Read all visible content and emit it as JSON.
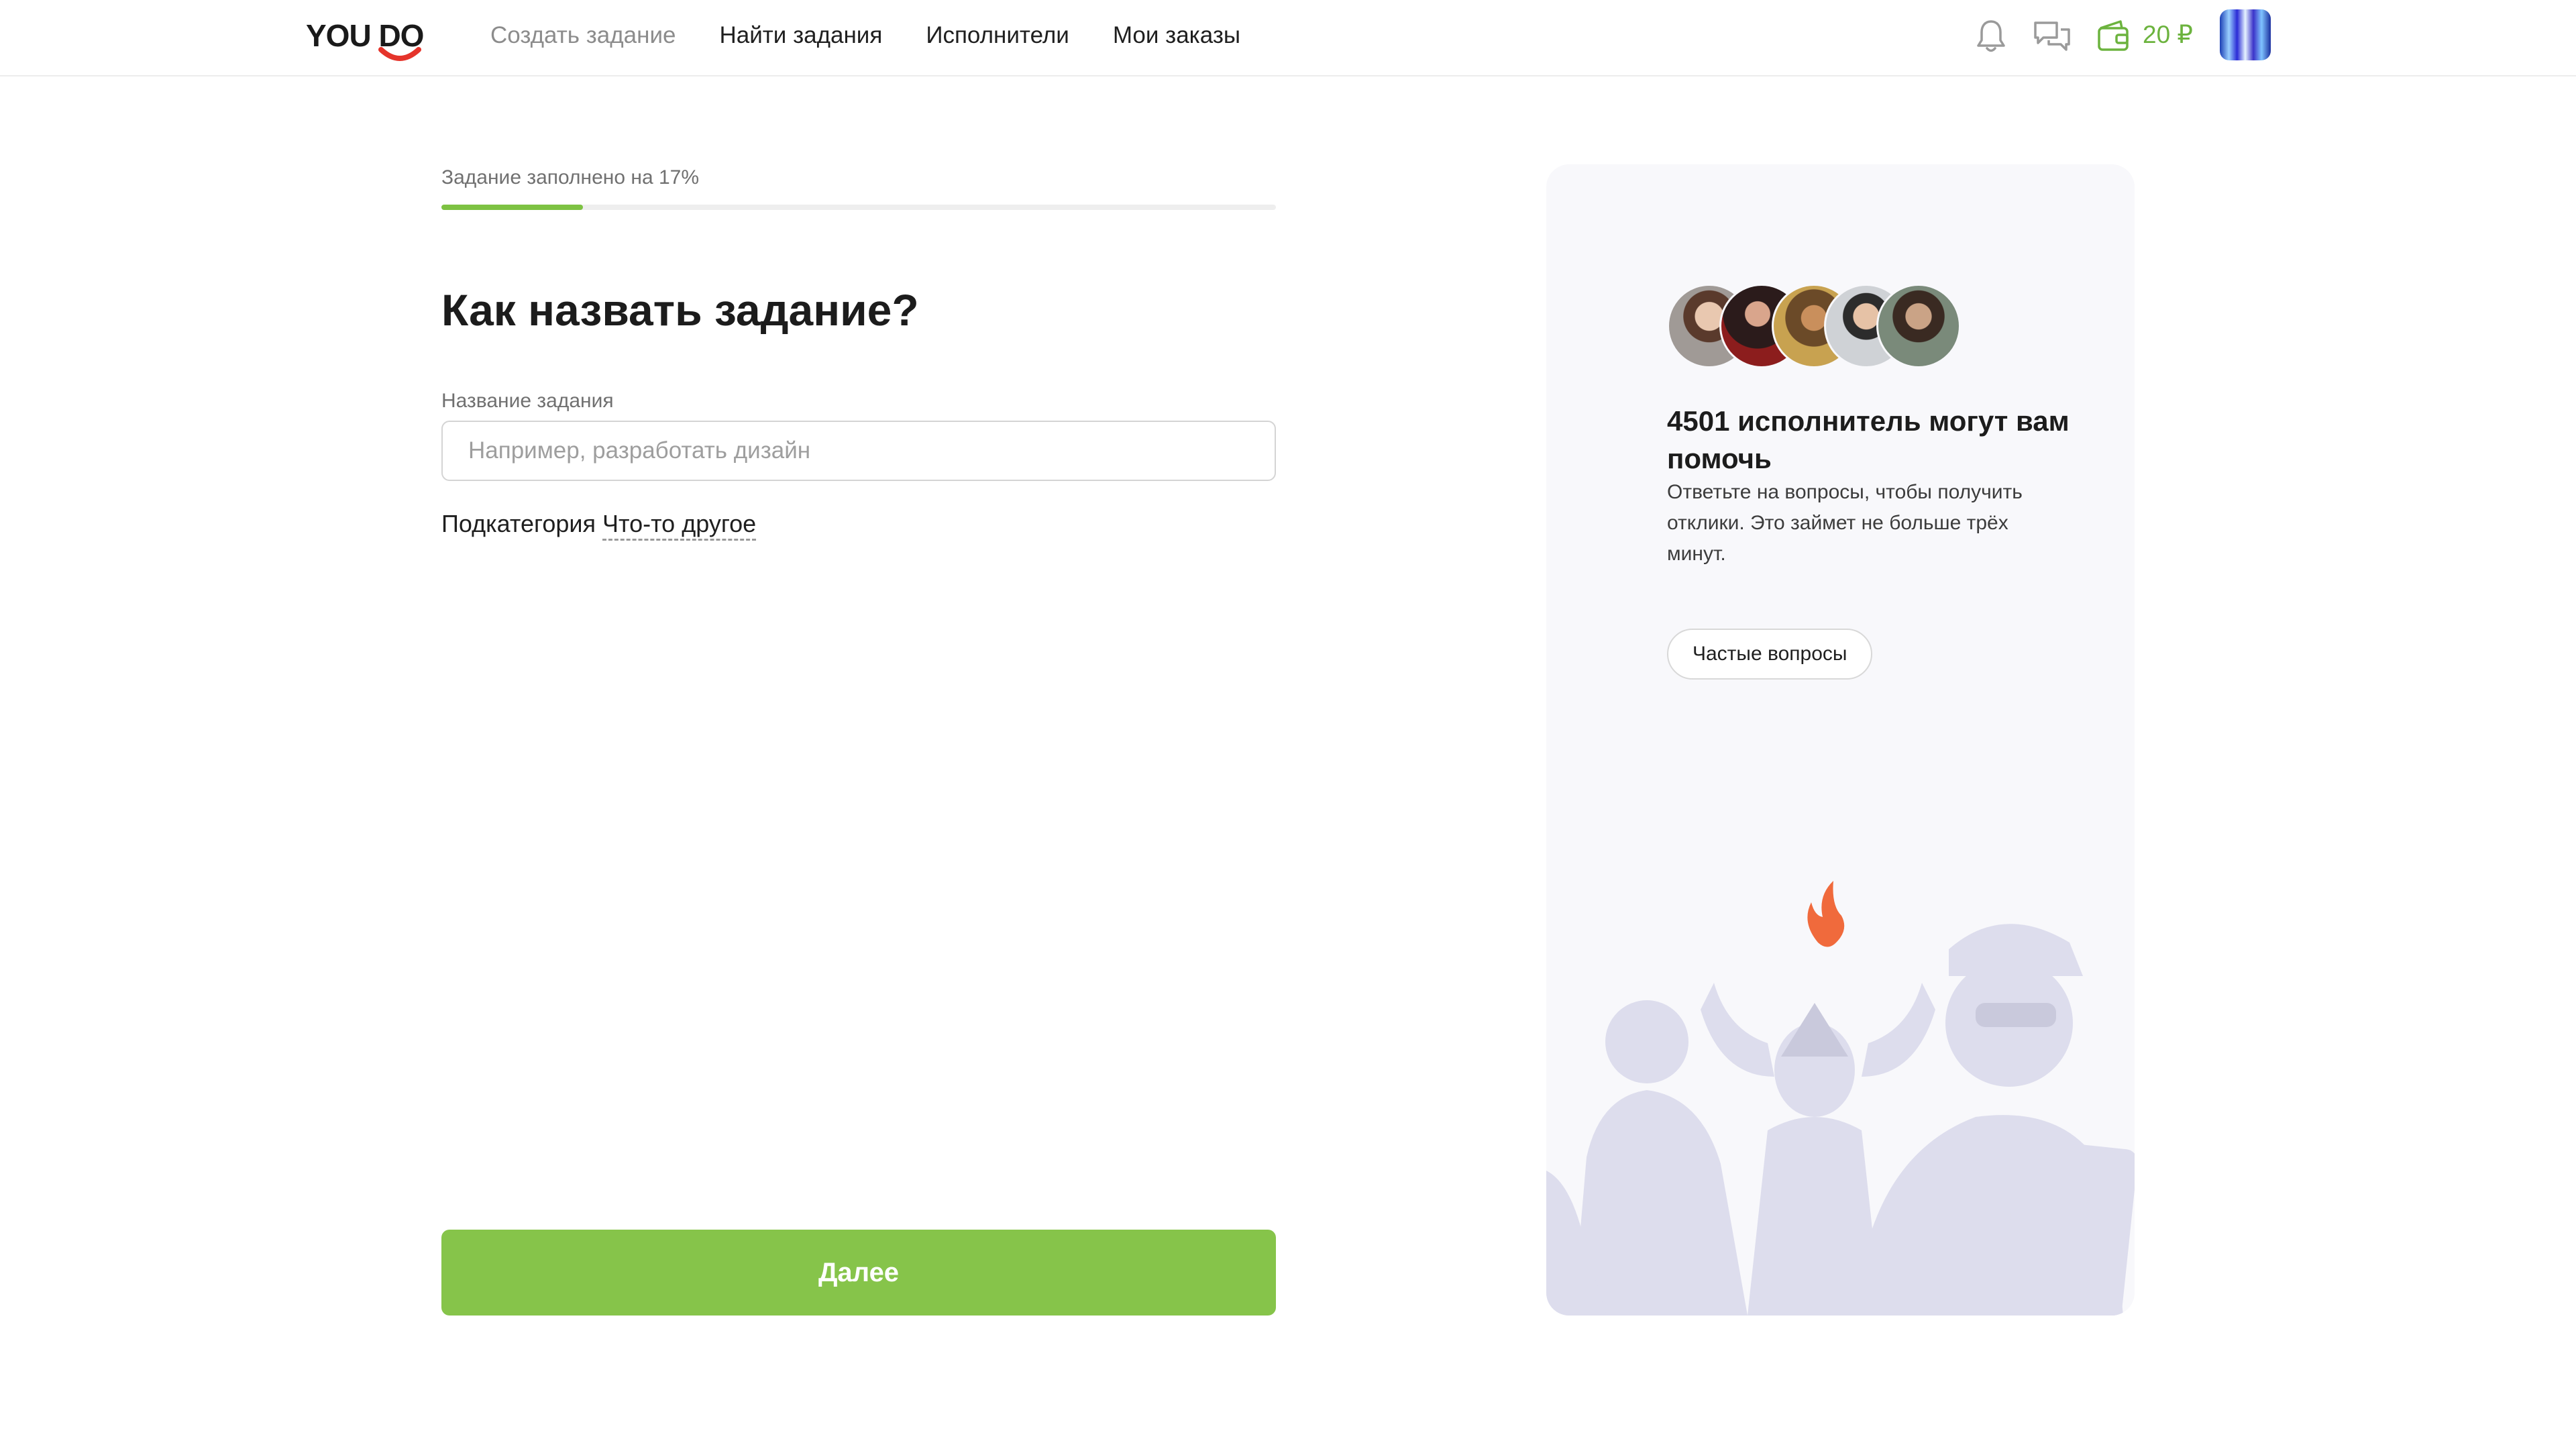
{
  "header": {
    "logo": {
      "text": "YOU DO"
    },
    "nav": [
      {
        "label": "Создать задание",
        "active": false
      },
      {
        "label": "Найти задания"
      },
      {
        "label": "Исполнители"
      },
      {
        "label": "Мои заказы"
      }
    ],
    "icons": [
      "bell-icon",
      "chat-icon",
      "wallet-icon"
    ],
    "balance": "20 ₽"
  },
  "form": {
    "progress_label": "Задание заполнено на 17%",
    "progress_percent": 17,
    "title": "Как назвать задание?",
    "field_label": "Название задания",
    "field_placeholder": "Например, разработать дизайн",
    "field_value": "",
    "subcategory_label": "Подкатегория",
    "subcategory_value": "Что-то другое",
    "next_label": "Далее"
  },
  "sidebar": {
    "title": "4501 исполнитель могут вам помочь",
    "text": "Ответьте на вопросы, чтобы получить отклики. Это займет не больше трёх минут.",
    "faq_label": "Частые вопросы",
    "avatars_count": 5
  },
  "colors": {
    "accent_green": "#86c44a",
    "progress_green": "#7dc242",
    "balance_green": "#6cb33e",
    "flame": "#f06a3c",
    "illustration": "#dcdcec"
  }
}
